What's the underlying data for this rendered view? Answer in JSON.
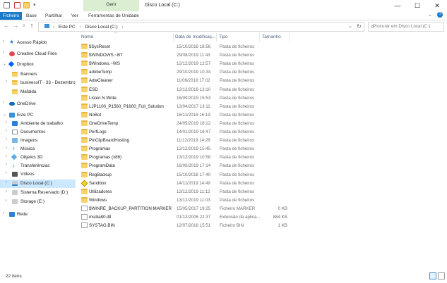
{
  "window": {
    "title": "Disco Local (C:)",
    "manage_tab": "Gerir",
    "controls": {
      "minimize": "—",
      "maximize": "☐",
      "close": "✕"
    }
  },
  "ribbon": {
    "tabs": [
      "Ficheiro",
      "Base",
      "Partilhar",
      "Ver",
      "Ferramentas de Unidade"
    ],
    "accent": "#1979ca"
  },
  "address": {
    "crumbs": [
      "Este PC",
      "Disco Local (C:)"
    ],
    "separator": "›",
    "search_placeholder": "Procurar em Disco Local (C:)"
  },
  "nav": {
    "items": [
      {
        "label": "Acesso Rápido",
        "icon": "star-icon"
      },
      {
        "label": "Creative Cloud Files",
        "icon": "creative-cloud-icon"
      },
      {
        "label": "Dropbox",
        "icon": "dropbox-icon"
      },
      {
        "label": "Banners",
        "icon": "folder-icon"
      },
      {
        "label": "businessIT - 33 - Dezembro",
        "icon": "folder-icon"
      },
      {
        "label": "Mafalda",
        "icon": "folder-icon"
      },
      {
        "label": "OneDrive",
        "icon": "onedrive-icon"
      },
      {
        "label": "Este PC",
        "icon": "pc-icon"
      },
      {
        "label": "Ambiente de trabalho",
        "icon": "desktop-icon"
      },
      {
        "label": "Documentos",
        "icon": "documents-icon"
      },
      {
        "label": "Imagens",
        "icon": "pictures-icon"
      },
      {
        "label": "Música",
        "icon": "music-icon"
      },
      {
        "label": "Objetos 3D",
        "icon": "objects3d-icon"
      },
      {
        "label": "Transferências",
        "icon": "downloads-icon"
      },
      {
        "label": "Vídeos",
        "icon": "videos-icon"
      },
      {
        "label": "Disco Local (C:)",
        "icon": "drive-icon",
        "selected": true
      },
      {
        "label": "Sistema Reservado (D:)",
        "icon": "drive-icon"
      },
      {
        "label": "Storage (E:)",
        "icon": "drive-icon"
      },
      {
        "label": "Rede",
        "icon": "network-icon"
      }
    ]
  },
  "columns": {
    "name": "Nome",
    "date": "Data de modificaç...",
    "type": "Tipo",
    "size": "Tamanho"
  },
  "files": [
    {
      "name": "$SysReset",
      "date": "15/10/2018 18:56",
      "type": "Pasta de ficheiros",
      "size": "",
      "icon": "folder"
    },
    {
      "name": "$WINDOWS.~BT",
      "date": "29/08/2019 11:43",
      "type": "Pasta de ficheiros",
      "size": "",
      "icon": "folder"
    },
    {
      "name": "$Windows.~WS",
      "date": "12/12/2019 12:57",
      "type": "Pasta de ficheiros",
      "size": "",
      "icon": "folder"
    },
    {
      "name": "adobeTemp",
      "date": "29/10/2019 10:34",
      "type": "Pasta de ficheiros",
      "size": "",
      "icon": "folder"
    },
    {
      "name": "AdwCleaner",
      "date": "11/09/2018 17:02",
      "type": "Pasta de ficheiros",
      "size": "",
      "icon": "folder"
    },
    {
      "name": "ESD",
      "date": "12/12/2019 13:10",
      "type": "Pasta de ficheiros",
      "size": "",
      "icon": "folder"
    },
    {
      "name": "Listen N Write",
      "date": "16/09/2019 15:53",
      "type": "Pasta de ficheiros",
      "size": "",
      "icon": "folder"
    },
    {
      "name": "LJP1100_P1560_P1600_Full_Solution",
      "date": "13/04/2017 13:11",
      "type": "Pasta de ficheiros",
      "size": "",
      "icon": "folder"
    },
    {
      "name": "NoBot",
      "date": "16/11/2018 16:19",
      "type": "Pasta de ficheiros",
      "size": "",
      "icon": "folder"
    },
    {
      "name": "OneDriveTemp",
      "date": "24/05/2019 18:12",
      "type": "Pasta de ficheiros",
      "size": "",
      "icon": "folder"
    },
    {
      "name": "PerfLogs",
      "date": "14/01/2019 16:47",
      "type": "Pasta de ficheiros",
      "size": "",
      "icon": "folder"
    },
    {
      "name": "PinClipBoardHosting",
      "date": "11/12/2019 14:28",
      "type": "Pasta de ficheiros",
      "size": "",
      "icon": "folder"
    },
    {
      "name": "Programas",
      "date": "12/12/2019 15:45",
      "type": "Pasta de ficheiros",
      "size": "",
      "icon": "folder"
    },
    {
      "name": "Programas (x86)",
      "date": "13/12/2019 10:58",
      "type": "Pasta de ficheiros",
      "size": "",
      "icon": "folder"
    },
    {
      "name": "ProgramData",
      "date": "16/09/2019 17:14",
      "type": "Pasta de ficheiros",
      "size": "",
      "icon": "folder"
    },
    {
      "name": "RegBackup",
      "date": "15/10/2018 17:40",
      "type": "Pasta de ficheiros",
      "size": "",
      "icon": "folder"
    },
    {
      "name": "Sandbox",
      "date": "14/11/2019 14:49",
      "type": "Pasta de ficheiros",
      "size": "",
      "icon": "shield"
    },
    {
      "name": "Utilizadores",
      "date": "13/12/2019 11:12",
      "type": "Pasta de ficheiros",
      "size": "",
      "icon": "folder"
    },
    {
      "name": "Windows",
      "date": "13/12/2019 11:03",
      "type": "Pasta de ficheiros",
      "size": "",
      "icon": "folder"
    },
    {
      "name": "$WINRE_BACKUP_PARTITION.MARKER",
      "date": "15/05/2017 19:25",
      "type": "Ficheiro MARKER",
      "size": "0 KB",
      "icon": "file"
    },
    {
      "name": "msdia80.dll",
      "date": "01/12/2006 22:37",
      "type": "Extensão da aplica...",
      "size": "884 KB",
      "icon": "file"
    },
    {
      "name": "SYSTAG.BIN",
      "date": "12/07/2018 15:51",
      "type": "Ficheiro BIN",
      "size": "1 KB",
      "icon": "file"
    }
  ],
  "status": {
    "count": "22 itens"
  }
}
